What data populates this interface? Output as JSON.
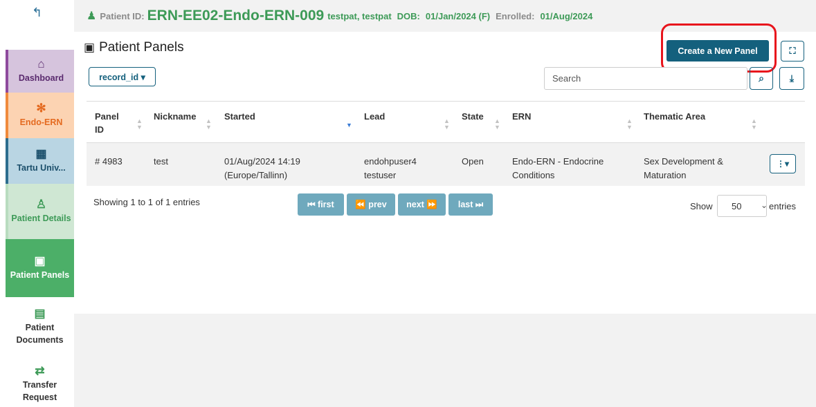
{
  "sidebar": {
    "back_icon": "arrow-back-icon",
    "items": [
      {
        "icon": "home-icon",
        "glyph": "⌂",
        "label": "Dashboard"
      },
      {
        "icon": "network-icon",
        "glyph": "✻",
        "label": "Endo-ERN"
      },
      {
        "icon": "hospital-icon",
        "glyph": "▦",
        "label": "Tartu Univ..."
      },
      {
        "icon": "patient-icon",
        "glyph": "♙",
        "label": "Patient Details"
      },
      {
        "icon": "clipboard-icon",
        "glyph": "▣",
        "label": "Patient Panels"
      },
      {
        "icon": "document-icon",
        "glyph": "▤",
        "label": "Patient Documents"
      },
      {
        "icon": "shuffle-icon",
        "glyph": "⇄",
        "label": "Transfer Request"
      }
    ]
  },
  "header": {
    "patient_icon": "patient-icon",
    "patient_id_label": "Patient ID:",
    "patient_id": "ERN-EE02-Endo-ERN-009",
    "patient_name": "testpat, testpat",
    "dob_label": "DOB:",
    "dob": "01/Jan/2024 (F)",
    "enrolled_label": "Enrolled:",
    "enrolled": "01/Aug/2024"
  },
  "main": {
    "title": "Patient Panels",
    "title_icon": "clipboard-icon",
    "create_button": "Create a New Panel",
    "fullscreen_icon": "expand-icon",
    "record_dropdown": "record_id ▾",
    "search_placeholder": "Search",
    "search_icon": "search-icon",
    "download_icon": "download-icon"
  },
  "table": {
    "columns": [
      "Panel ID",
      "Nickname",
      "Started",
      "Lead",
      "State",
      "ERN",
      "Thematic Area"
    ],
    "rows": [
      {
        "panel_id": "# 4983",
        "nickname": "test",
        "started_date": "01/Aug/2024 14:19",
        "started_tz": "(Europe/Tallinn)",
        "lead_line1": "endohpuser4",
        "lead_line2": "testuser",
        "state": "Open",
        "ern_line1": "Endo-ERN - Endocrine",
        "ern_line2": "Conditions",
        "thematic_line1": "Sex Development &",
        "thematic_line2": "Maturation",
        "actions_icon": "more-vertical-icon"
      }
    ]
  },
  "footer": {
    "info": "Showing 1 to 1 of 1 entries",
    "first": "⏮ first",
    "prev": "⏪ prev",
    "next": "next ⏩",
    "last": "last ⏭",
    "show_label": "Show",
    "page_size": "50",
    "entries_label": "entries"
  },
  "colors": {
    "primary": "#14607d",
    "green": "#3d9a57",
    "highlight": "#e8141c"
  }
}
